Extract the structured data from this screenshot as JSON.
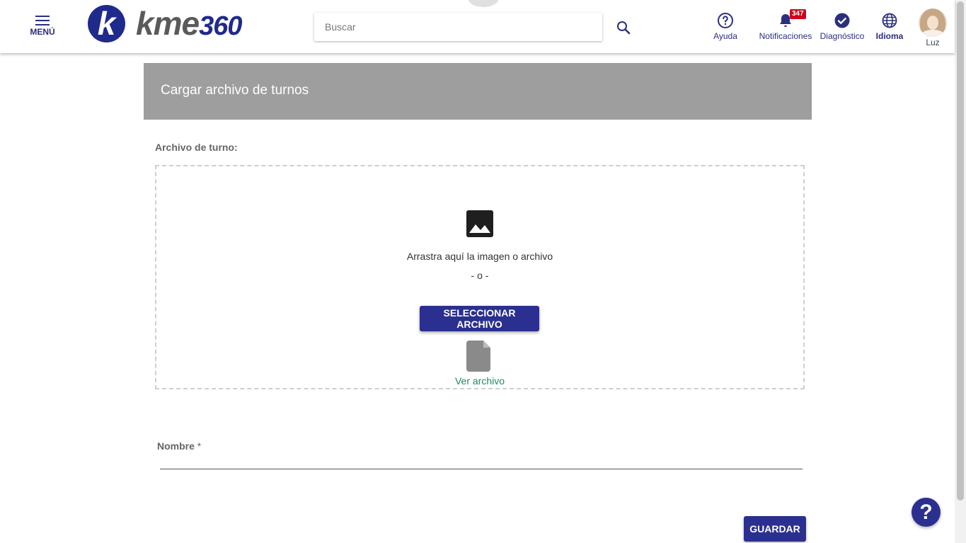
{
  "header": {
    "menu_label": "MENÚ",
    "logo_letter": "k",
    "logo_text": "kme",
    "logo_number": "360",
    "search_placeholder": "Buscar",
    "nav": {
      "ayuda": "Ayuda",
      "notificaciones": "Notificaciones",
      "notifications_count": "347",
      "diagnostico": "Diagnóstico",
      "idioma": "Idioma",
      "user": "Luz"
    }
  },
  "page": {
    "title": "Cargar archivo de turnos",
    "file_field_label": "Archivo de turno:",
    "dropzone": {
      "drag_text": "Arrastra aquí la imagen o archivo",
      "separator": "- o -",
      "select_button": "SELECCIONAR ARCHIVO",
      "view_file_link": "Ver archivo"
    },
    "name_field": {
      "label": "Nombre",
      "required_mark": " *",
      "value": ""
    },
    "save_button": "GUARDAR",
    "help_fab": "?"
  },
  "colors": {
    "brand_blue": "#2b2f8f",
    "header_gray": "#9e9e9e",
    "link_green": "#1e8a6a",
    "badge_red": "#d0021b"
  }
}
